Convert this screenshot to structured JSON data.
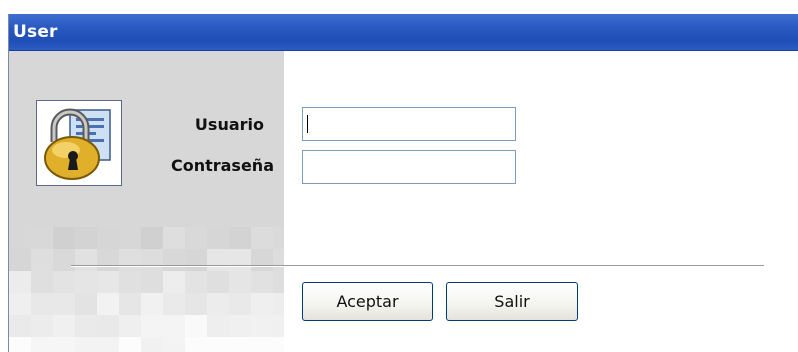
{
  "window": {
    "title": "User"
  },
  "form": {
    "username_label": "Usuario",
    "password_label": "Contraseña",
    "username_value": "",
    "password_value": ""
  },
  "buttons": {
    "accept_label": "Aceptar",
    "exit_label": "Salir"
  },
  "icons": {
    "dialog_icon": "padlock-icon"
  },
  "colors": {
    "titlebar": "#2858c0",
    "left_pane": "#d7d7d7",
    "input_border": "#7f9db9",
    "button_border": "#003c74"
  }
}
